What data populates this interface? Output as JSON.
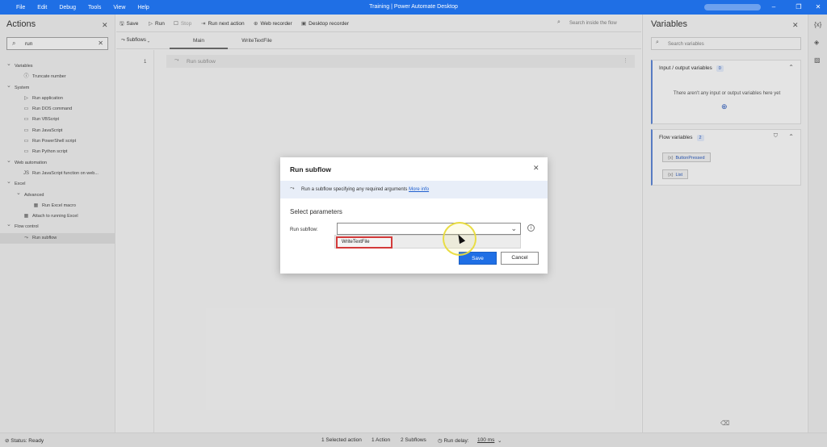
{
  "titlebar": {
    "menu": [
      "File",
      "Edit",
      "Debug",
      "Tools",
      "View",
      "Help"
    ],
    "title": "Training | Power Automate Desktop",
    "buttons": {
      "minimize": "–",
      "restore": "❐",
      "close": "✕"
    }
  },
  "actions_pane": {
    "title": "Actions",
    "search_value": "run",
    "tree": [
      {
        "type": "cat",
        "label": "Variables"
      },
      {
        "type": "item",
        "icon": "ⓘ",
        "label": "Truncate number"
      },
      {
        "type": "cat",
        "label": "System"
      },
      {
        "type": "item",
        "icon": "▷",
        "label": "Run application"
      },
      {
        "type": "item",
        "icon": "▭",
        "label": "Run DOS command"
      },
      {
        "type": "item",
        "icon": "▭",
        "label": "Run VBScript"
      },
      {
        "type": "item",
        "icon": "▭",
        "label": "Run JavaScript"
      },
      {
        "type": "item",
        "icon": "▭",
        "label": "Run PowerShell script"
      },
      {
        "type": "item",
        "icon": "▭",
        "label": "Run Python script"
      },
      {
        "type": "cat",
        "label": "Web automation"
      },
      {
        "type": "item",
        "icon": "JS",
        "label": "Run JavaScript function on web..."
      },
      {
        "type": "cat",
        "label": "Excel"
      },
      {
        "type": "sub",
        "label": "Advanced"
      },
      {
        "type": "item2",
        "icon": "▦",
        "label": "Run Excel macro"
      },
      {
        "type": "item",
        "icon": "▦",
        "label": "Attach to running Excel"
      },
      {
        "type": "cat",
        "label": "Flow control"
      },
      {
        "type": "item",
        "icon": "⤳",
        "label": "Run subflow",
        "selected": true
      }
    ]
  },
  "toolbar": {
    "save": "Save",
    "run": "Run",
    "stop": "Stop",
    "run_next": "Run next action",
    "web_recorder": "Web recorder",
    "desktop_recorder": "Desktop recorder",
    "search_placeholder": "Search inside the flow"
  },
  "tabs": {
    "subflows": "Subflows",
    "items": [
      "Main",
      "WriteTextFile"
    ]
  },
  "canvas": {
    "line_number": "1",
    "action_label": "Run subflow"
  },
  "variables_pane": {
    "title": "Variables",
    "search_placeholder": "Search variables",
    "io_section": {
      "title": "Input / output variables",
      "count": "0",
      "empty_text": "There aren't any input or output variables here yet"
    },
    "flow_section": {
      "title": "Flow variables",
      "count": "2",
      "vars": [
        "ButtonPressed",
        "List"
      ]
    }
  },
  "dialog": {
    "title": "Run subflow",
    "info_text": "Run a subflow specifying any required arguments",
    "info_link": "More info",
    "section": "Select parameters",
    "field_label": "Run subflow:",
    "field_value": "",
    "dropdown_option": "WriteTextFile",
    "save": "Save",
    "cancel": "Cancel"
  },
  "statusbar": {
    "status": "Status: Ready",
    "selected": "1 Selected action",
    "actions": "1 Action",
    "subflows": "2 Subflows",
    "run_delay_label": "Run delay:",
    "run_delay_value": "100 ms"
  },
  "colors": {
    "accent": "#1f6fe5",
    "highlight_border": "#d33b3b",
    "cursor_highlight": "#e9dc3c"
  }
}
